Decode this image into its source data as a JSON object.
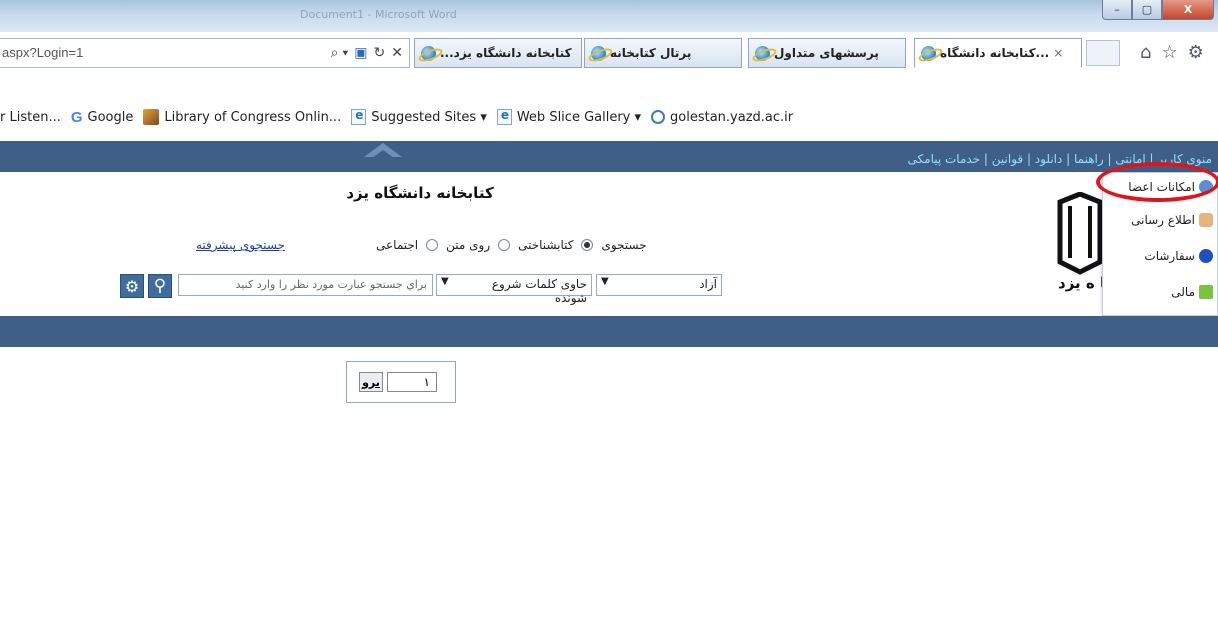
{
  "window": {
    "title": "Document1 - Microsoft Word",
    "buttons": {
      "minimize": "–",
      "maximize": "▢",
      "close": "X"
    }
  },
  "browser": {
    "address": "aspx?Login=1",
    "address_icons": [
      "⌕ ▾",
      "▣",
      "↻",
      "✕"
    ],
    "tabs": [
      {
        "label": "كتابخانه دانشگاه يزد...",
        "active": false
      },
      {
        "label": "...كتابخانه",
        "active": false
      },
      {
        "label": "پرتال كتابخانه",
        "active": false
      },
      {
        "label": "پرسشهای متداول",
        "active": false
      },
      {
        "label": "...كتابخانه دانشگاه",
        "active": true,
        "close": "×"
      }
    ],
    "command_icons": [
      "⌂",
      "☆",
      "⚙"
    ]
  },
  "favorites": [
    {
      "label": "r Listen...",
      "icon": "none"
    },
    {
      "label": "Google",
      "icon": "google-icon"
    },
    {
      "label": "Library of Congress Onlin...",
      "icon": "library-icon"
    },
    {
      "label": "Suggested Sites ▾",
      "icon": "page-icon"
    },
    {
      "label": "Web Slice Gallery ▾",
      "icon": "page-icon"
    },
    {
      "label": "golestan.yazd.ac.ir",
      "icon": "site-icon"
    }
  ],
  "site": {
    "top_links": "منوی کاربر | امانتی  | راهنما | دانلود | قوانين | خدمات پيامكی",
    "title": "كتابخانه دانشگاه يزد",
    "logo_text": "کا ه یزد",
    "search_label": "جستجوی",
    "search_options": [
      "كتابشناختی",
      "روی متن",
      "اجتماعی"
    ],
    "selected_option": "كتابشناختی",
    "advanced_search": "جستجوی پیشرفته",
    "field_select": "آزاد",
    "match_select": "حاوی كلمات شروع شونده",
    "search_placeholder": "براي جستجو عبارت مورد نظر را وارد كنيد",
    "pager": {
      "go_label": "برو",
      "page_value": "١"
    }
  },
  "user_menu": [
    {
      "label": "امكانات اعضا",
      "icon": "members-icon",
      "highlighted": true
    },
    {
      "label": "اطلاع رسانی",
      "icon": "person-icon"
    },
    {
      "label": "سفارشات",
      "icon": "info-icon"
    },
    {
      "label": "مالی",
      "icon": "money-icon"
    }
  ],
  "colors": {
    "nav_bar": "#3f5f87",
    "highlight_ring": "#e0141d",
    "link": "#8fe0ff"
  }
}
